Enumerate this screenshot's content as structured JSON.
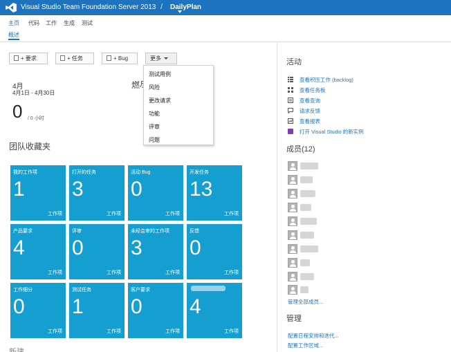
{
  "header": {
    "app_title": "Visual Studio Team Foundation Server 2013",
    "separator": "/",
    "project": "DailyPlan"
  },
  "nav": {
    "items": [
      "主页",
      "代码",
      "工作",
      "生成",
      "测试"
    ],
    "active": "主页",
    "subnav": "概述"
  },
  "toolbar": {
    "buttons": [
      {
        "label": "+ 要求",
        "icon": "requirement-icon"
      },
      {
        "label": "+ 任务",
        "icon": "task-icon"
      },
      {
        "label": "+ Bug",
        "icon": "bug-icon"
      }
    ],
    "more_label": "更多"
  },
  "more_menu": {
    "items": [
      "测试用例",
      "风险",
      "更改请求",
      "功能",
      "评审",
      "问题"
    ]
  },
  "sprint": {
    "month": "4月",
    "range": "4月1日 - 4月30日",
    "hours": "0",
    "hours_unit": "/ 0 小时",
    "burndown_label": "燃尽"
  },
  "favorites": {
    "title": "团队收藏夹",
    "tiles": [
      {
        "label": "我的工作项",
        "count": "1",
        "unit": "工作项"
      },
      {
        "label": "打开的任务",
        "count": "3",
        "unit": "工作项"
      },
      {
        "label": "活动 Bug",
        "count": "0",
        "unit": "工作项"
      },
      {
        "label": "开发任务",
        "count": "13",
        "unit": "工作项"
      },
      {
        "label": "产品要求",
        "count": "4",
        "unit": "工作项"
      },
      {
        "label": "评审",
        "count": "0",
        "unit": "工作项"
      },
      {
        "label": "未经会审的工作项",
        "count": "3",
        "unit": "工作项"
      },
      {
        "label": "反馈",
        "count": "0",
        "unit": "工作项"
      },
      {
        "label": "工作细分",
        "count": "0",
        "unit": "工作项"
      },
      {
        "label": "测试任务",
        "count": "1",
        "unit": "工作项"
      },
      {
        "label": "客户要求",
        "count": "0",
        "unit": "工作项"
      },
      {
        "label": "",
        "count": "4",
        "unit": "工作项"
      }
    ]
  },
  "bottom_cut": "新建文",
  "activity": {
    "title": "活动",
    "links": [
      {
        "label": "查看积压工作 (backlog)",
        "icon": "list-icon"
      },
      {
        "label": "查看任务板",
        "icon": "board-icon"
      },
      {
        "label": "查看查询",
        "icon": "query-icon"
      },
      {
        "label": "请求反馈",
        "icon": "feedback-icon"
      },
      {
        "label": "查看报表",
        "icon": "report-icon"
      },
      {
        "label": "打开 Visual Studio 的新实例",
        "icon": "visual-studio-icon"
      }
    ]
  },
  "members": {
    "title": "成员(12)",
    "manage_link": "管理全部成员..."
  },
  "admin": {
    "title": "管理",
    "links": [
      "配置日程安排和迭代...",
      "配置工作区域..."
    ]
  }
}
